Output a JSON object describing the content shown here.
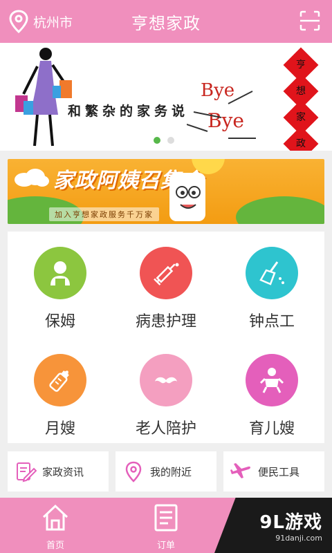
{
  "header": {
    "location": "杭州市",
    "title": "亨想家政"
  },
  "banner": {
    "text": "和繁杂的家务说",
    "bye1": "Bye",
    "bye2": "Bye",
    "fuzi": [
      "亨",
      "想",
      "家",
      "政"
    ],
    "active_slide": 1,
    "slide_count": 2
  },
  "promo": {
    "title": "家政阿姨召集令",
    "subtitle": "加入亨想家政服务千万家"
  },
  "services": [
    {
      "label": "保姆",
      "icon": "nanny-icon",
      "color": "#8cc63f"
    },
    {
      "label": "病患护理",
      "icon": "syringe-icon",
      "color": "#f05454"
    },
    {
      "label": "钟点工",
      "icon": "broom-icon",
      "color": "#2ec4cf"
    },
    {
      "label": "月嫂",
      "icon": "baby-bottle-icon",
      "color": "#f7943a"
    },
    {
      "label": "老人陪护",
      "icon": "mustache-icon",
      "color": "#f49fc0"
    },
    {
      "label": "育儿嫂",
      "icon": "baby-icon",
      "color": "#e45fbb"
    }
  ],
  "quick_links": [
    {
      "label": "家政资讯",
      "icon": "news-edit-icon"
    },
    {
      "label": "我的附近",
      "icon": "location-pin-icon"
    },
    {
      "label": "便民工具",
      "icon": "airplane-icon"
    }
  ],
  "bottom_nav": [
    {
      "label": "首页",
      "icon": "home-icon"
    },
    {
      "label": "订单",
      "icon": "order-list-icon"
    }
  ],
  "watermark": {
    "main": "9L游戏",
    "sub": "91danji.com"
  },
  "colors": {
    "brand_pink": "#f08fbd",
    "accent_pink": "#e45fbb"
  }
}
